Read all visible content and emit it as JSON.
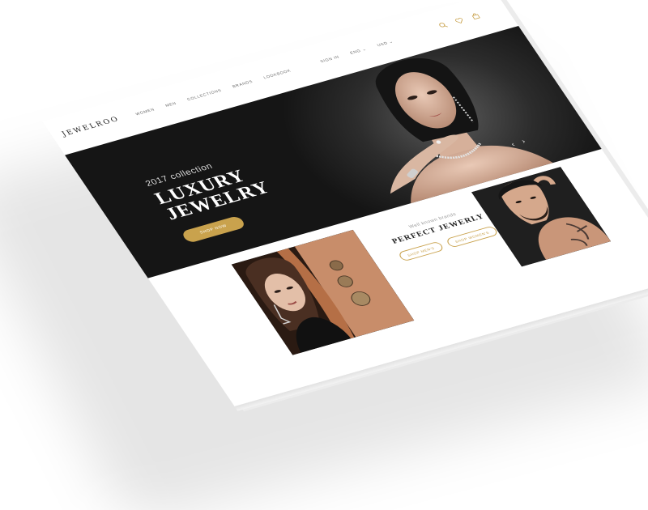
{
  "site": {
    "logo": "JEWELROO"
  },
  "nav": {
    "items": [
      "Women",
      "Men",
      "Collections",
      "Brands",
      "Lookbook"
    ],
    "account": "Sign in",
    "currency": "Eng",
    "language": "USD"
  },
  "header_icons": [
    "search-icon",
    "heart-icon",
    "bag-icon"
  ],
  "hero": {
    "subtitle": "2017 collection",
    "title": "LUXURY JEWELRY",
    "button": "Shop now",
    "arrows": [
      "‹",
      "›"
    ]
  },
  "promo": {
    "subtitle": "Well known brands",
    "title": "PERFECT JEWERLY",
    "button_men": "Shop men's",
    "button_women": "Shop women's"
  },
  "colors": {
    "accent": "#c9a24d",
    "hero_bg": "#1c1c1c",
    "text_dark": "#222222"
  }
}
